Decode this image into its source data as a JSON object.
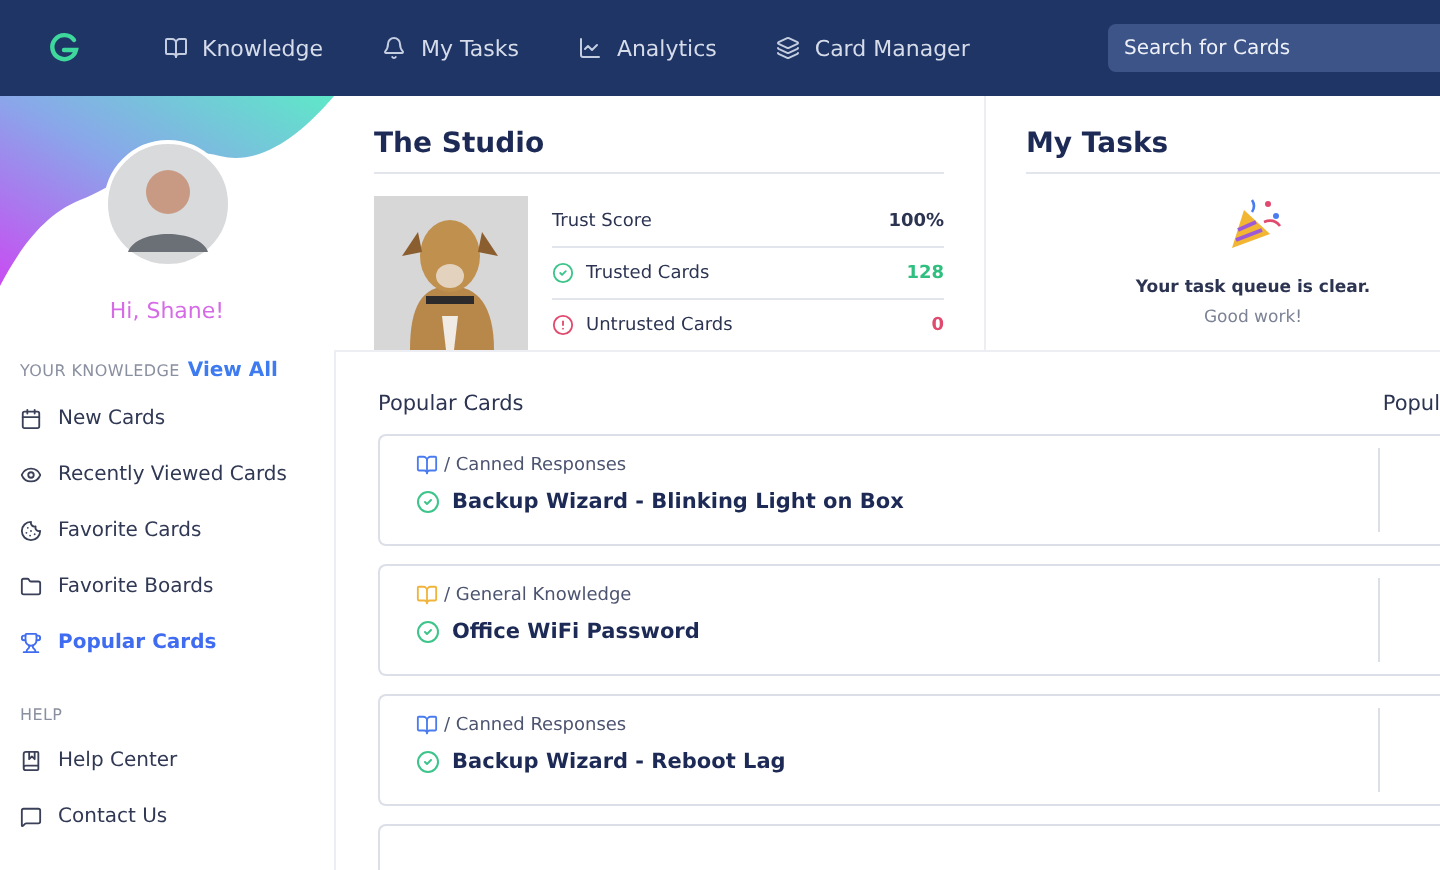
{
  "nav": {
    "items": [
      {
        "label": "Knowledge",
        "selected": false
      },
      {
        "label": "My Tasks",
        "selected": false
      },
      {
        "label": "Analytics",
        "selected": false
      },
      {
        "label": "Card Manager",
        "selected": false
      }
    ],
    "search": {
      "placeholder": "Search for Cards"
    }
  },
  "sidebar": {
    "greeting": "Hi, Shane!",
    "sections": [
      {
        "title": "YOUR KNOWLEDGE",
        "link": "View All",
        "items": [
          {
            "label": "New Cards",
            "selected": false
          },
          {
            "label": "Recently Viewed Cards",
            "selected": false
          },
          {
            "label": "Favorite Cards",
            "selected": false
          },
          {
            "label": "Favorite Boards",
            "selected": false
          },
          {
            "label": "Popular Cards",
            "selected": true
          }
        ]
      },
      {
        "title": "HELP",
        "items": [
          {
            "label": "Help Center",
            "selected": false
          },
          {
            "label": "Contact Us",
            "selected": false
          }
        ]
      }
    ]
  },
  "studio": {
    "title": "The Studio",
    "stats": [
      {
        "kind": "plain",
        "label": "Trust Score",
        "value": "100%"
      },
      {
        "kind": "trusted",
        "label": "Trusted Cards",
        "value": "128"
      },
      {
        "kind": "untrusted",
        "label": "Untrusted Cards",
        "value": "0"
      }
    ]
  },
  "tasks": {
    "title": "My Tasks",
    "message": "Your task queue is clear.",
    "sub": "Good work!"
  },
  "popular": {
    "title": "Popular Cards",
    "column_2": "Popul",
    "cards": [
      {
        "collection": "/ Canned Responses",
        "color": "#4a7cf0",
        "title": "Backup Wizard - Blinking Light on Box"
      },
      {
        "collection": "/ General Knowledge",
        "color": "#f0b43c",
        "title": "Office WiFi Password"
      },
      {
        "collection": "/ Canned Responses",
        "color": "#4a7cf0",
        "title": "Backup Wizard - Reboot Lag"
      }
    ]
  }
}
